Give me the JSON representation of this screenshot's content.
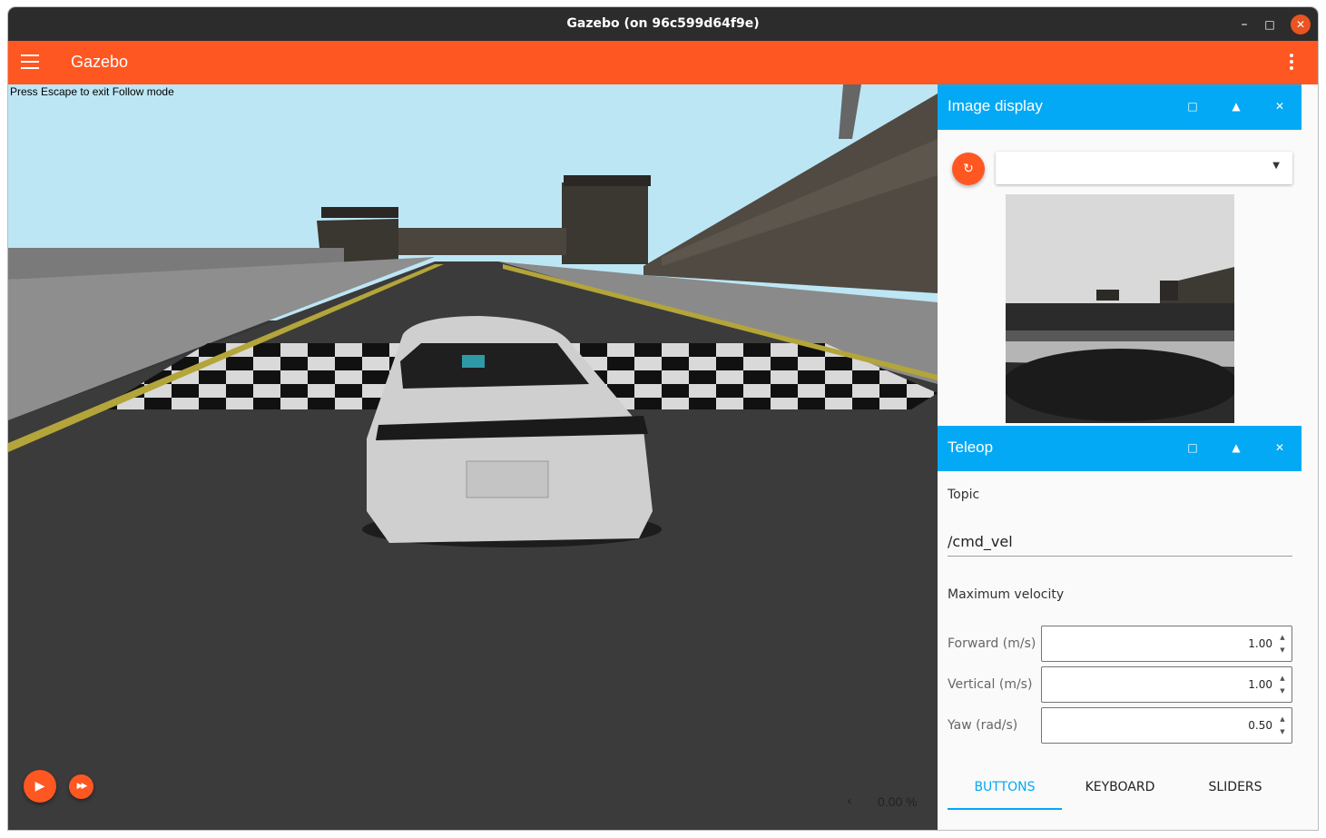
{
  "window": {
    "title": "Gazebo (on 96c599d64f9e)",
    "minimize_glyph": "–",
    "maximize_glyph": "□",
    "close_glyph": "✕"
  },
  "appbar": {
    "title": "Gazebo",
    "menu_icon": "hamburger-menu-icon",
    "overflow_icon": "more-vert-icon",
    "color": "#ff5722"
  },
  "scene": {
    "hint": "Press Escape to exit Follow mode",
    "play_glyph": "▶",
    "step_glyph": "▶▶",
    "rtf_chevron": "‹",
    "real_time_factor": "0.00 %"
  },
  "image_display": {
    "title": "Image display",
    "refresh_glyph": "↻",
    "topic_value": "",
    "caret_glyph": "▼",
    "header_buttons": [
      "□",
      "▲",
      "✕"
    ]
  },
  "teleop": {
    "title": "Teleop",
    "header_buttons": [
      "□",
      "▲",
      "✕"
    ],
    "topic_label": "Topic",
    "topic_value": "/cmd_vel",
    "max_velocity_label": "Maximum velocity",
    "fields": [
      {
        "label": "Forward (m/s)",
        "value": "1.00"
      },
      {
        "label": "Vertical (m/s)",
        "value": "1.00"
      },
      {
        "label": "Yaw (rad/s)",
        "value": "0.50"
      }
    ],
    "spin_up": "▲",
    "spin_down": "▼",
    "tabs": [
      {
        "label": "BUTTONS",
        "active": true
      },
      {
        "label": "KEYBOARD",
        "active": false
      },
      {
        "label": "SLIDERS",
        "active": false
      }
    ]
  },
  "colors": {
    "accent_orange": "#ff5722",
    "accent_blue": "#03a9f4",
    "titlebar": "#2c2c2c"
  }
}
